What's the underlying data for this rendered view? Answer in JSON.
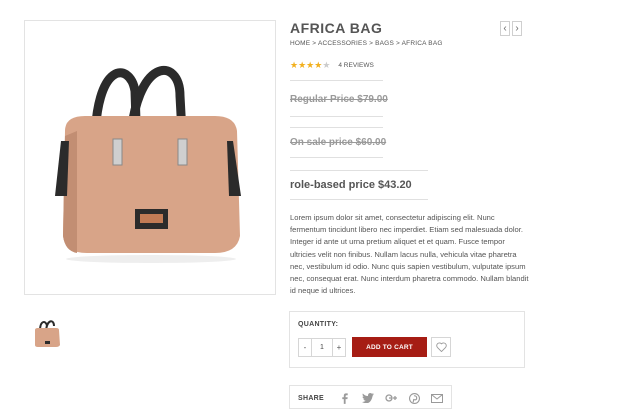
{
  "product": {
    "title": "AFRICA BAG",
    "breadcrumb": "HOME > ACCESSORIES > BAGS > AFRICA BAG",
    "rating": {
      "stars": 4,
      "max": 5,
      "reviews_label": "4 REVIEWS"
    },
    "prices": {
      "regular": "Regular Price $79.00",
      "sale": "On sale price $60.00",
      "role_based": "role-based price $43.20"
    },
    "description": "Lorem ipsum dolor sit amet, consectetur adipiscing elit. Nunc fermentum tincidunt libero nec imperdiet. Etiam sed malesuada dolor. Integer id ante ut urna pretium aliquet et et quam. Fusce tempor ultricies velit non finibus. Nullam lacus nulla, vehicula vitae pharetra nec, vestibulum id odio. Nunc quis sapien vestibulum, vulputate ipsum nec, consequat erat. Nunc interdum pharetra commodo. Nullam blandit id neque id ultrices."
  },
  "nav": {
    "prev": "‹",
    "next": "›"
  },
  "cart": {
    "quantity_label": "QUANTITY:",
    "minus": "-",
    "quantity_value": "1",
    "plus": "+",
    "add_label": "ADD TO CART"
  },
  "share": {
    "label": "SHARE",
    "icons": [
      "facebook-icon",
      "twitter-icon",
      "google-plus-icon",
      "pinterest-icon",
      "email-icon"
    ]
  },
  "colors": {
    "accent": "#a61d14",
    "star": "#f2b01e",
    "star_empty": "#cccccc"
  }
}
